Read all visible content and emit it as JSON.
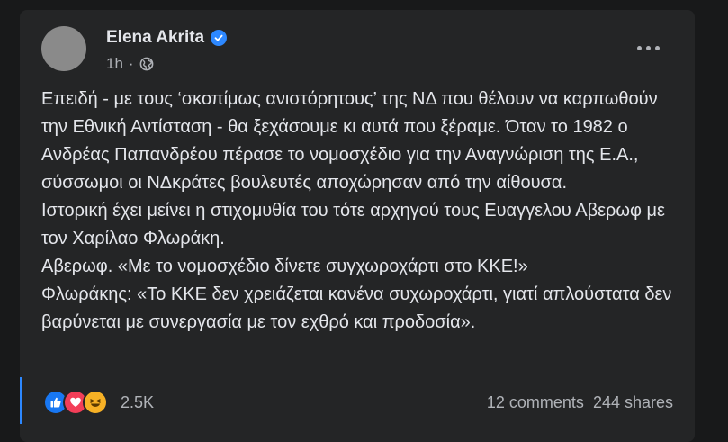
{
  "post": {
    "author": "Elena Akrita",
    "time": "1h",
    "separator": "·",
    "paragraphs": [
      "Επειδή - με τους ‘σκοπίμως ανιστόρητους’ της ΝΔ που θέλουν να καρπωθούν την Εθνική Αντίσταση - θα ξεχάσουμε κι αυτά που ξέραμε. Όταν το 1982 ο Ανδρέας Παπανδρέου πέρασε το νομοσχέδιο για την Αναγνώριση της Ε.Α., σύσσωμοι οι ΝΔκράτες βουλευτές αποχώρησαν από την αίθουσα.",
      "Ιστορική έχει μείνει η στιχομυθία του τότε αρχηγού τους Ευαγγελου Αβερωφ με τον Χαρίλαο Φλωράκη.",
      "Αβερωφ. «Με το νομοσχέδιο δίνετε συγχωροχάρτι στο ΚΚΕ!»",
      "Φλωράκης: «Το ΚΚΕ δεν χρειάζεται κανένα συχωροχάρτι, γιατί απλούστατα δεν βαρύνεται με συνεργασία με τον εχθρό και προδοσία»."
    ],
    "reaction_icons": [
      "like-icon",
      "love-icon",
      "haha-icon"
    ],
    "reaction_count": "2.5K",
    "comments": "12 comments",
    "shares": "244 shares"
  },
  "colors": {
    "page_bg": "#18191a",
    "card_bg": "#242526",
    "text_primary": "#e4e6eb",
    "text_secondary": "#b0b3b8",
    "accent": "#2d88ff",
    "like": "#1877f2",
    "love": "#f33e58",
    "haha": "#f7b125"
  }
}
